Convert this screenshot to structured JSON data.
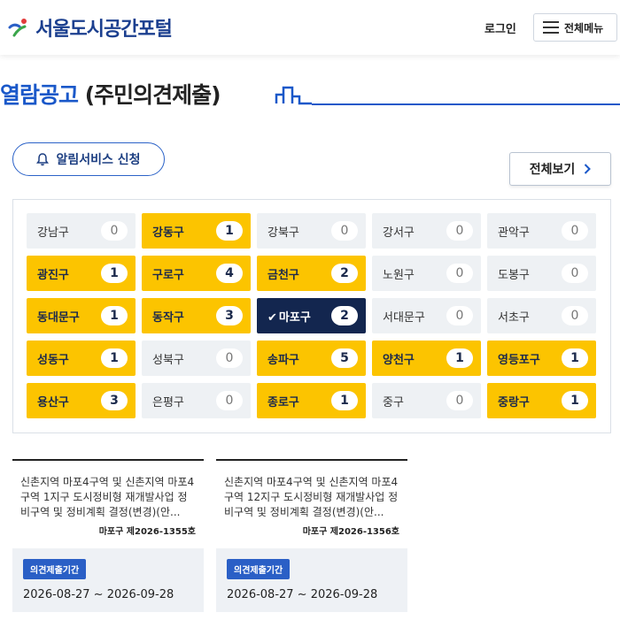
{
  "header": {
    "logo_text": "서울도시공간포털",
    "login_label": "로그인",
    "menu_label": "전체메뉴"
  },
  "title": {
    "highlight": "열람공고",
    "rest": " (주민의견제출)"
  },
  "alert_button": {
    "label": "알림서비스 신청",
    "icon": "bell-icon"
  },
  "view_all": {
    "label": "전체보기",
    "icon": "chevron-right-icon"
  },
  "colors": {
    "active": "#fcc400",
    "selected": "#13264f",
    "inactive": "#eef1f4",
    "brand_blue": "#1a58c9"
  },
  "districts": [
    {
      "name": "강남구",
      "count": "0",
      "state": "off"
    },
    {
      "name": "강동구",
      "count": "1",
      "state": "on"
    },
    {
      "name": "강북구",
      "count": "0",
      "state": "off"
    },
    {
      "name": "강서구",
      "count": "0",
      "state": "off"
    },
    {
      "name": "관악구",
      "count": "0",
      "state": "off"
    },
    {
      "name": "광진구",
      "count": "1",
      "state": "on"
    },
    {
      "name": "구로구",
      "count": "4",
      "state": "on"
    },
    {
      "name": "금천구",
      "count": "2",
      "state": "on"
    },
    {
      "name": "노원구",
      "count": "0",
      "state": "off"
    },
    {
      "name": "도봉구",
      "count": "0",
      "state": "off"
    },
    {
      "name": "동대문구",
      "count": "1",
      "state": "on"
    },
    {
      "name": "동작구",
      "count": "3",
      "state": "on"
    },
    {
      "name": "마포구",
      "count": "2",
      "state": "sel"
    },
    {
      "name": "서대문구",
      "count": "0",
      "state": "off"
    },
    {
      "name": "서초구",
      "count": "0",
      "state": "off"
    },
    {
      "name": "성동구",
      "count": "1",
      "state": "on"
    },
    {
      "name": "성북구",
      "count": "0",
      "state": "off"
    },
    {
      "name": "송파구",
      "count": "5",
      "state": "on"
    },
    {
      "name": "양천구",
      "count": "1",
      "state": "on"
    },
    {
      "name": "영등포구",
      "count": "1",
      "state": "on"
    },
    {
      "name": "용산구",
      "count": "3",
      "state": "on"
    },
    {
      "name": "은평구",
      "count": "0",
      "state": "off"
    },
    {
      "name": "종로구",
      "count": "1",
      "state": "on"
    },
    {
      "name": "중구",
      "count": "0",
      "state": "off"
    },
    {
      "name": "중랑구",
      "count": "1",
      "state": "on"
    }
  ],
  "cards": [
    {
      "summary": "신촌지역 마포4구역 및 신촌지역 마포4구역 1지구 도시정비형 재개발사업 정비구역 및 정비계획 결정(변경)(안...",
      "code": "마포구 제2026-1355호",
      "tag": "의견제출기간",
      "period": "2026-08-27 ~ 2026-09-28"
    },
    {
      "summary": "신촌지역 마포4구역 및 신촌지역 마포4구역 12지구 도시정비형 재개발사업 정비구역 및 정비계획 결정(변경)(안...",
      "code": "마포구 제2026-1356호",
      "tag": "의견제출기간",
      "period": "2026-08-27 ~ 2026-09-28"
    }
  ]
}
